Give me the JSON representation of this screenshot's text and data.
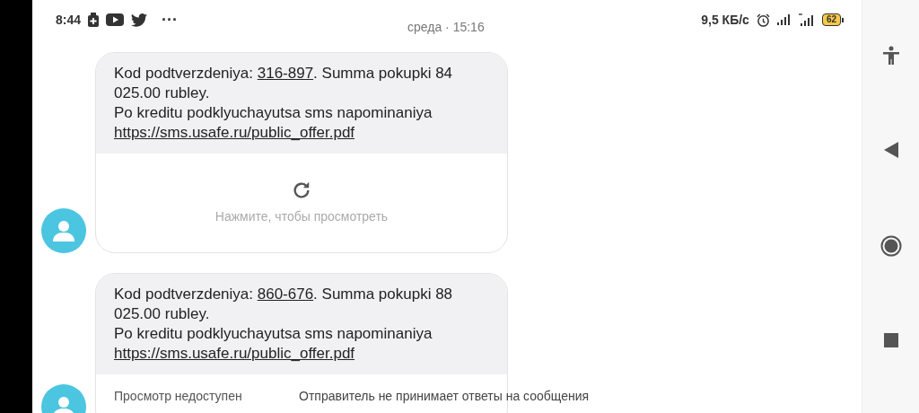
{
  "status_bar": {
    "time": "8:44",
    "more": "···",
    "speed": "9,5 КБ/с",
    "battery": "62"
  },
  "date_header": "среда · 15:16",
  "messages": [
    {
      "prefix": "Kod podtverzdeniya: ",
      "code": "316-897",
      "suffix": ". Summa pokupki 84 025.00 rubley.",
      "line2": "Po kreditu podklyuchayutsa sms napominaniya",
      "link": "https://sms.usafe.ru/public_offer.pdf",
      "preview": {
        "kind": "reload",
        "text": "Нажмите, чтобы просмотреть"
      }
    },
    {
      "prefix": "Kod podtverzdeniya: ",
      "code": "860-676",
      "suffix": ". Summa pokupki 88 025.00 rubley.",
      "line2": "Po kreditu podklyuchayutsa sms napominaniya",
      "link": "https://sms.usafe.ru/public_offer.pdf",
      "preview": {
        "kind": "unavailable",
        "text": "Просмотр недоступен"
      }
    }
  ],
  "footer_note": "Отправитель не принимает ответы на сообщения"
}
